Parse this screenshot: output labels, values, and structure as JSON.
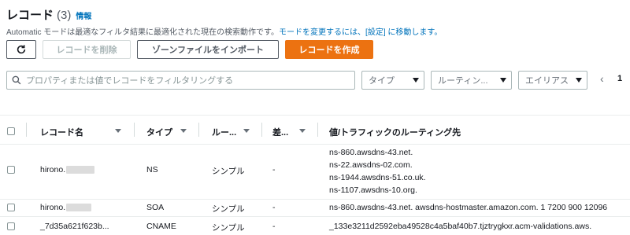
{
  "header": {
    "title": "レコード",
    "count": "(3)",
    "info": "情報",
    "subtitle_prefix": "Automatic モードは最適なフィルタ結果に最適化された現在の検索動作です。",
    "subtitle_link": "モードを変更するには、[設定] に移動します。"
  },
  "toolbar": {
    "refresh_icon": "refresh-icon",
    "delete_label": "レコードを削除",
    "import_label": "ゾーンファイルをインポート",
    "create_label": "レコードを作成"
  },
  "filter": {
    "search_placeholder": "プロパティまたは値でレコードをフィルタリングする",
    "type_dropdown": "タイプ",
    "routing_dropdown": "ルーティン...",
    "alias_dropdown": "エイリアス",
    "page_number": "1"
  },
  "table": {
    "columns": [
      "レコード名",
      "タイプ",
      "ルー...",
      "差...",
      "値/トラフィックのルーティング先"
    ],
    "rows": [
      {
        "name": "hirono.",
        "type": "NS",
        "routing": "シンプル",
        "diff": "-",
        "values": [
          "ns-860.awsdns-43.net.",
          "ns-22.awsdns-02.com.",
          "ns-1944.awsdns-51.co.uk.",
          "ns-1107.awsdns-10.org."
        ]
      },
      {
        "name": "hirono.",
        "type": "SOA",
        "routing": "シンプル",
        "diff": "-",
        "values": [
          "ns-860.awsdns-43.net. awsdns-hostmaster.amazon.com. 1 7200 900 12096"
        ]
      },
      {
        "name": "_7d35a621f623b...",
        "type": "CNAME",
        "routing": "シンプル",
        "diff": "-",
        "values": [
          "_133e3211d2592eba49528c4a5baf40b7.tjztrygkxr.acm-validations.aws."
        ]
      }
    ]
  },
  "colors": {
    "primary": "#ec7211",
    "link": "#0073bb"
  }
}
